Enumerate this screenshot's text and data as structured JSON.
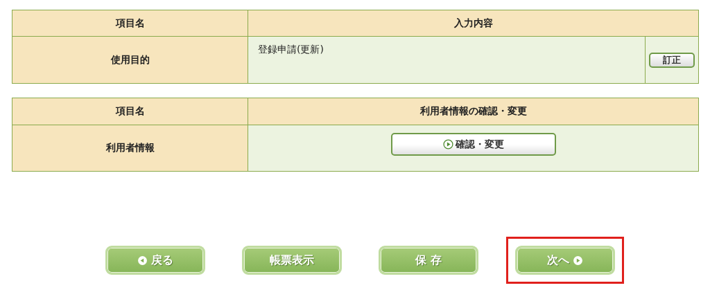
{
  "purpose_table": {
    "columns": [
      "項目名",
      "入力内容"
    ],
    "row": {
      "label": "使用目的",
      "value": "登録申請(更新)",
      "button": "訂正"
    }
  },
  "user_table": {
    "columns": [
      "項目名",
      "利用者情報の確認・変更"
    ],
    "row": {
      "label": "利用者情報",
      "button": "確認・変更"
    }
  },
  "buttons": [
    {
      "label": "戻る",
      "kind": "back",
      "highlighted": false
    },
    {
      "label": "帳票表示",
      "kind": "plain",
      "highlighted": false
    },
    {
      "label": "保 存",
      "kind": "plain",
      "highlighted": false
    },
    {
      "label": "次へ",
      "kind": "next",
      "highlighted": true
    }
  ]
}
